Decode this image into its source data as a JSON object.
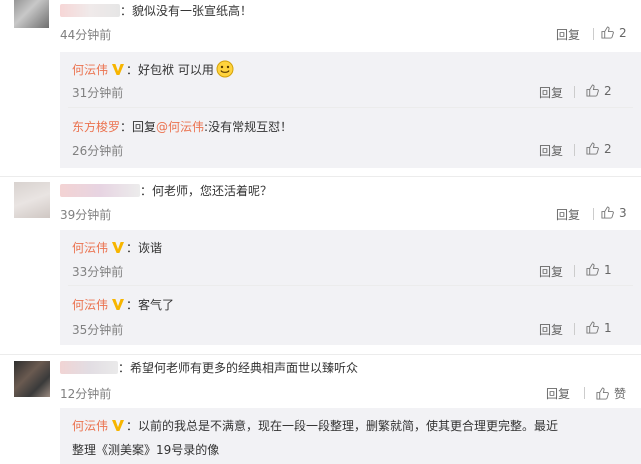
{
  "comments": [
    {
      "colon_text": "：貌似没有一张宣纸高！",
      "time": "44分钟前",
      "reply_label": "回复",
      "likes": "2",
      "replies": [
        {
          "author": "何沄伟",
          "body": "：好包袱 可以用",
          "time": "31分钟前",
          "reply_label": "回复",
          "likes": "2"
        },
        {
          "author": "东方梭罗",
          "body_prefix": "：回复",
          "mention": "@何沄伟",
          "body": ":没有常规互怼！",
          "time": "26分钟前",
          "reply_label": "回复",
          "likes": "2"
        }
      ]
    },
    {
      "colon_text": "：何老师，您还活着呢？",
      "time": "39分钟前",
      "reply_label": "回复",
      "likes": "3",
      "replies": [
        {
          "author": "何沄伟",
          "body": "：诙谐",
          "time": "33分钟前",
          "reply_label": "回复",
          "likes": "1"
        },
        {
          "author": "何沄伟",
          "body": "：客气了",
          "time": "35分钟前",
          "reply_label": "回复",
          "likes": "1"
        }
      ]
    },
    {
      "colon_text": "：希望何老师有更多的经典相声面世以臻听众",
      "time": "12分钟前",
      "reply_label": "回复",
      "likes": "赞",
      "replies": [
        {
          "author": "何沄伟",
          "body": "：以前的我总是不满意，现在一段一段整理，删繁就简，使其更合理更完整。最近",
          "body_line2": "整理《测美案》19号录的像"
        }
      ]
    }
  ],
  "colors": {
    "accent": "#eb7350",
    "vip_badge": "#f7b500",
    "reply_bg": "#f2f2f5",
    "meta": "#808080"
  },
  "icons": {
    "like": "thumbs-up-icon",
    "verified": "vip-v-icon",
    "emoji": "smile-emoji-icon"
  }
}
